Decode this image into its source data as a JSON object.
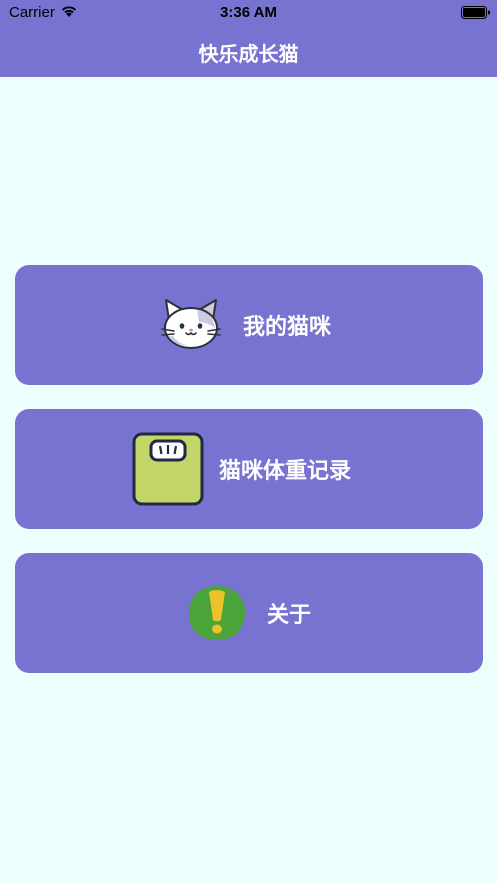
{
  "status_bar": {
    "carrier": "Carrier",
    "time": "3:36 AM"
  },
  "nav": {
    "title": "快乐成长猫"
  },
  "menu": [
    {
      "label": "我的猫咪",
      "icon": "cat-face-icon"
    },
    {
      "label": "猫咪体重记录",
      "icon": "weight-scale-icon"
    },
    {
      "label": "关于",
      "icon": "exclamation-icon"
    }
  ],
  "colors": {
    "accent": "#7872D0",
    "background": "#ECFFFD",
    "label": "#FFFFFF",
    "scale_body": "#C4D66A",
    "about_green": "#4BA43A",
    "about_yellow": "#EBC12C"
  }
}
